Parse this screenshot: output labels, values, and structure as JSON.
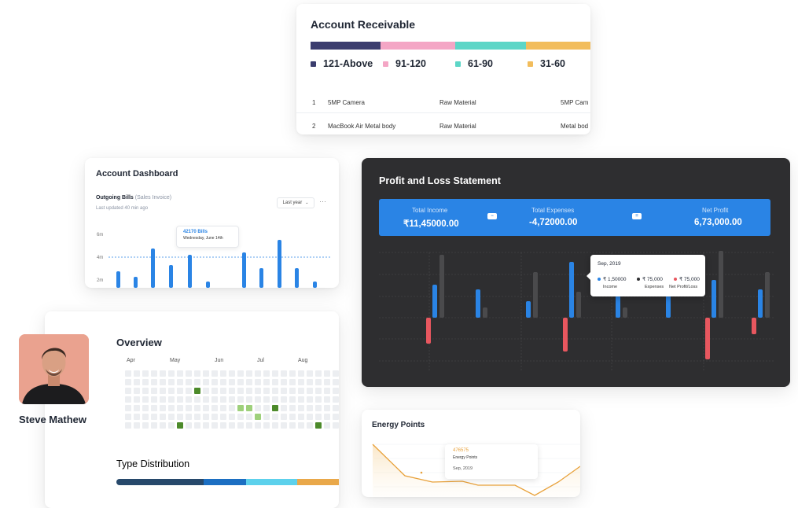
{
  "account_receivable": {
    "title": "Account Receivable",
    "segments": [
      {
        "label": "121-Above",
        "color": "#3b3d6e",
        "share": 0.25
      },
      {
        "label": "91-120",
        "color": "#f4a6c5",
        "share": 0.25
      },
      {
        "label": "61-90",
        "color": "#5dd6c7",
        "share": 0.25
      },
      {
        "label": "31-60",
        "color": "#f2bd5c",
        "share": 0.25
      }
    ],
    "rows": [
      {
        "num": "1",
        "item": "5MP Camera",
        "type": "Raw Material",
        "extra": "5MP Cam"
      },
      {
        "num": "2",
        "item": "MacBook Air Metal body",
        "type": "Raw Material",
        "extra": "Metal bod"
      }
    ]
  },
  "account_dashboard": {
    "title": "Account Dashboard",
    "subtitle": "Outgoing Bills",
    "subtitle_note": "(Sales Invoice)",
    "updated": "Last updated 40 min ago",
    "period": "Last year",
    "more": "···",
    "tooltip_value": "42170 Bills",
    "tooltip_date": "Wednesday, June 14th",
    "y_ticks": [
      "6m",
      "4m",
      "2m"
    ],
    "accent": "#2a84e5"
  },
  "profile": {
    "name": "Steve Mathew"
  },
  "overview": {
    "title": "Overview",
    "months": [
      "Apr",
      "May",
      "Jun",
      "Jul",
      "Aug"
    ],
    "type_title": "Type Distribution",
    "type_segments": [
      {
        "color": "#27496b",
        "share": 0.39
      },
      {
        "color": "#1c6fc2",
        "share": 0.19
      },
      {
        "color": "#5dd1ec",
        "share": 0.23
      },
      {
        "color": "#e9a84a",
        "share": 0.19
      }
    ]
  },
  "profit_loss": {
    "title": "Profit and Loss Statement",
    "total_income_label": "Total Income",
    "total_income": "₹11,45000.00",
    "minus": "−",
    "total_expenses_label": "Total Expenses",
    "total_expenses": "-4,72000.00",
    "equals": "=",
    "net_profit_label": "Net Profit",
    "net_profit": "6,73,000.00",
    "tooltip": {
      "title": "Sep, 2019",
      "income": "₹ 1,50000",
      "expenses": "₹ 75,000",
      "net": "₹ 75,000",
      "income_label": "Income",
      "expenses_label": "Expenses",
      "net_label": "Net Profit/Loss"
    },
    "colors": {
      "income": "#2a84e5",
      "expenses": "#4a4a4c",
      "net": "#e8575f"
    }
  },
  "energy_points": {
    "title": "Energy Points",
    "tooltip_value": "476575",
    "tooltip_label": "Energy Points",
    "tooltip_date": "Sep, 2019",
    "accent": "#e8a13a"
  }
}
